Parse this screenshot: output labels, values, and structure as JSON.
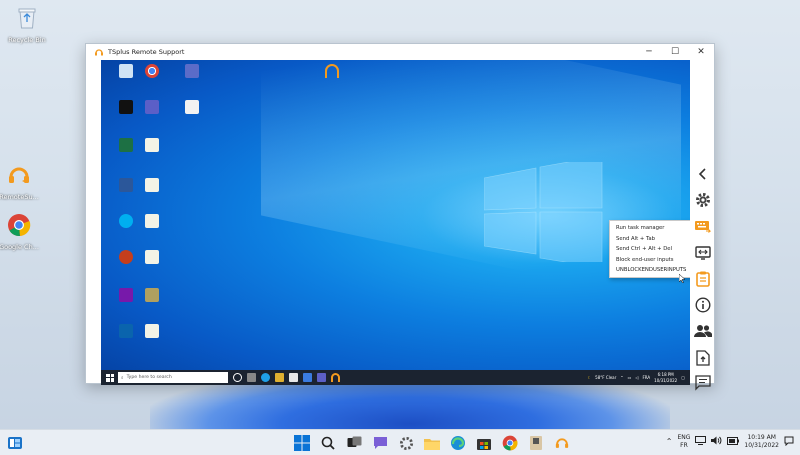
{
  "local_desktop": {
    "icons": [
      {
        "label": "Recycle Bin",
        "icon": "recycle-bin-icon"
      },
      {
        "label": "RemoteSu...",
        "icon": "tsplus-remote-support-icon"
      },
      {
        "label": "Google Ch...",
        "icon": "chrome-icon"
      }
    ]
  },
  "window": {
    "title": "TSplus Remote Support",
    "controls": {
      "minimize": "─",
      "maximize": "☐",
      "close": "✕"
    }
  },
  "remote_desktop": {
    "taskbar": {
      "search_placeholder": "Type here to search",
      "weather": "58°F Clear",
      "lang": "FRA",
      "time": "6:18 PM",
      "date": "10/31/2022"
    }
  },
  "context_menu": {
    "items": [
      "Run task manager",
      "Send Alt + Tab",
      "Send Ctrl + Alt + Del",
      "Block end-user inputs",
      "UNBLOCKENDUSERINPUTS"
    ]
  },
  "side_panel": {
    "buttons": [
      "collapse-chevron-icon",
      "settings-gear-icon",
      "keyboard-icon",
      "screen-switch-icon",
      "clipboard-icon",
      "info-icon",
      "users-icon",
      "file-upload-icon",
      "chat-icon"
    ]
  },
  "taskbar": {
    "lang_top": "ENG",
    "lang_bottom": "FR",
    "time": "10:19 AM",
    "date": "10/31/2022"
  },
  "colors": {
    "accent": "#0a74d6",
    "tsplus_orange": "#f39a1e"
  }
}
